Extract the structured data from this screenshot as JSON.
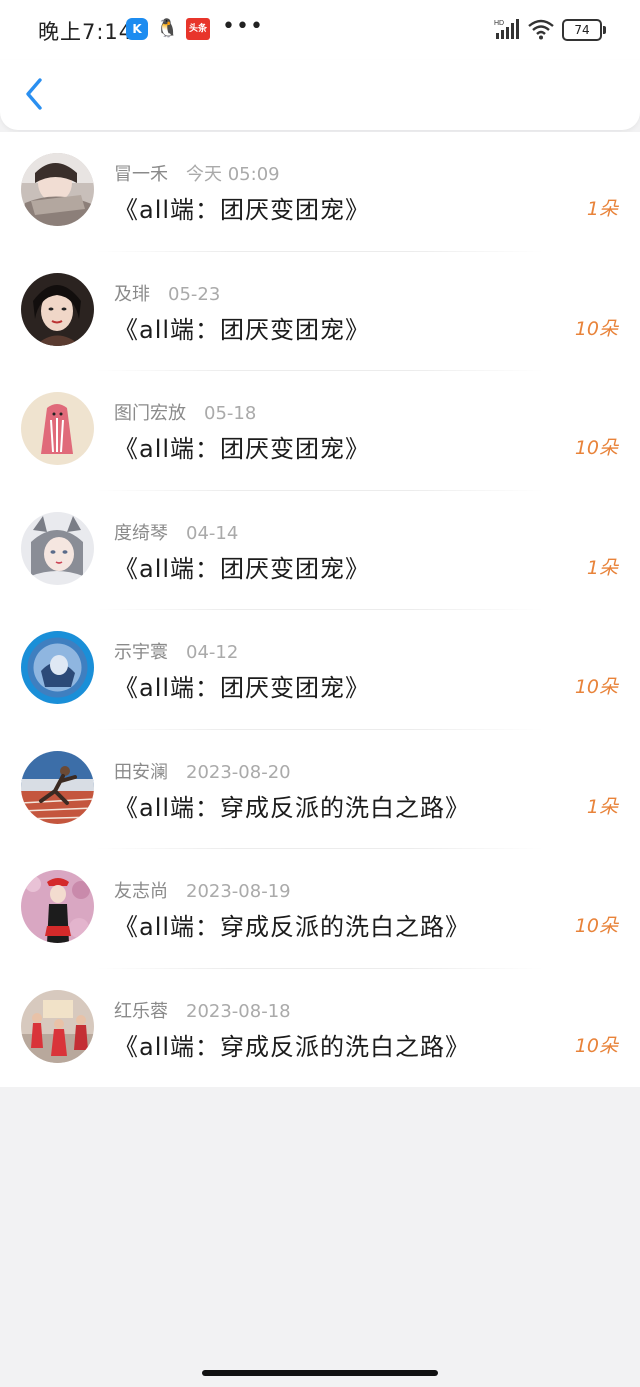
{
  "status_bar": {
    "time": "晚上7:14",
    "app_icons": [
      "kugou-icon",
      "qq-icon",
      "toutiao-icon"
    ],
    "app1_glyph": "K",
    "app2_glyph": "🐧",
    "app3_glyph": "头条",
    "more": "•••",
    "network": "HD",
    "battery": "74"
  },
  "colors": {
    "accent": "#2a8ff0",
    "gift": "#e8833a",
    "name": "#8a8a8a",
    "date": "#aaaaaa"
  },
  "header": {
    "back_icon": "chevron-left-icon"
  },
  "items": [
    {
      "name": "冒一禾",
      "date": "今天 05:09",
      "title": "《all端：团厌变团宠》",
      "gift": "1朵",
      "avatar": "girl-scarf"
    },
    {
      "name": "及琲",
      "date": "05-23",
      "title": "《all端：团厌变团宠》",
      "gift": "10朵",
      "avatar": "woman-portrait"
    },
    {
      "name": "图门宏放",
      "date": "05-18",
      "title": "《all端：团厌变团宠》",
      "gift": "10朵",
      "avatar": "cartoon-pink"
    },
    {
      "name": "度绮琴",
      "date": "04-14",
      "title": "《all端：团厌变团宠》",
      "gift": "1朵",
      "avatar": "anime-cat-girl"
    },
    {
      "name": "示宇寰",
      "date": "04-12",
      "title": "《all端：团厌变团宠》",
      "gift": "10朵",
      "avatar": "blue-circle"
    },
    {
      "name": "田安澜",
      "date": "2023-08-20",
      "title": "《all端：穿成反派的洗白之路》",
      "gift": "1朵",
      "avatar": "runner"
    },
    {
      "name": "友志尚",
      "date": "2023-08-19",
      "title": "《all端：穿成反派的洗白之路》",
      "gift": "10朵",
      "avatar": "girl-red-hat"
    },
    {
      "name": "红乐蓉",
      "date": "2023-08-18",
      "title": "《all端：穿成反派的洗白之路》",
      "gift": "10朵",
      "avatar": "kids-dance"
    }
  ]
}
